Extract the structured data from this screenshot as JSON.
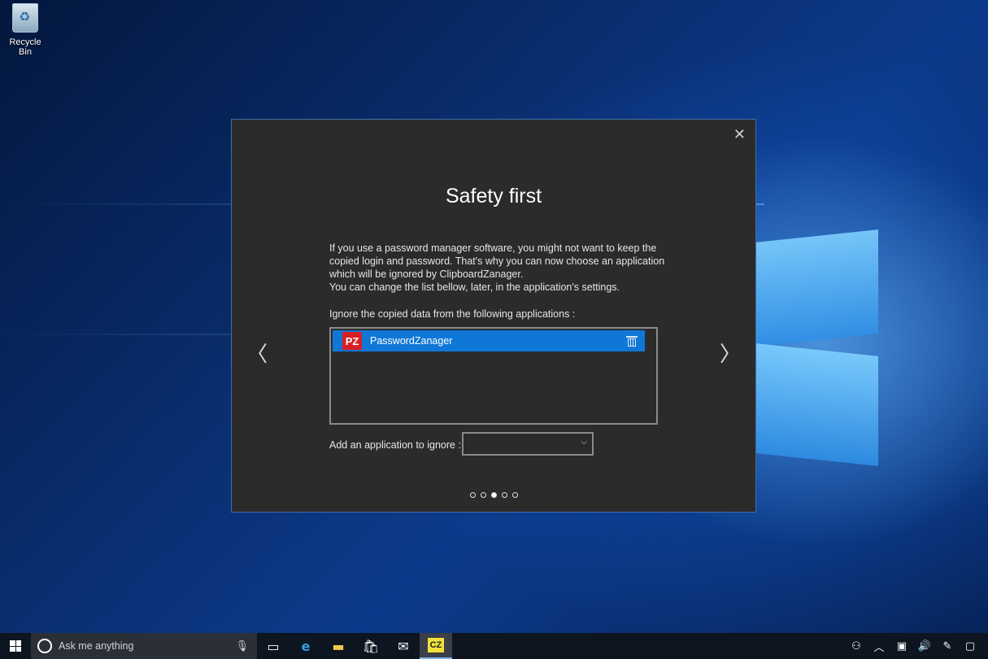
{
  "desktop": {
    "recycle_bin_label": "Recycle Bin"
  },
  "dialog": {
    "title": "Safety first",
    "close_glyph": "✕",
    "body_line1": "If you use a password manager software, you might not want to keep the copied login and password. That's why you can now choose an application which will be ignored by ClipboardZanager.",
    "body_line2": "You can change the list bellow, later, in the application's settings.",
    "ignore_label": "Ignore the copied data from the following applications :",
    "ignored_apps": [
      {
        "icon_text": "PZ",
        "name": "PasswordZanager",
        "icon_color": "#d91f26"
      }
    ],
    "add_label": "Add an application to ignore :",
    "add_select_value": "",
    "prev_glyph": "〈",
    "next_glyph": "〉",
    "pages_total": 5,
    "current_page": 3
  },
  "taskbar": {
    "search_placeholder": "Ask me anything",
    "app_badge": "CZ",
    "accent_color": "#0f78d7"
  }
}
